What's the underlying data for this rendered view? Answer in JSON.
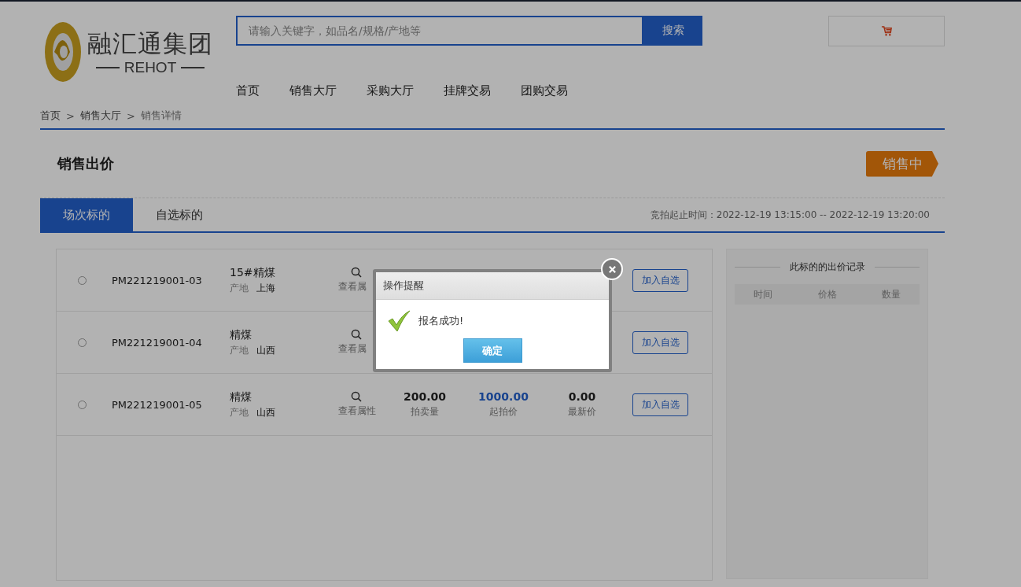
{
  "logo": {
    "name": "融汇通集团",
    "sub": "REHOT"
  },
  "search": {
    "placeholder": "请输入关键字，如品名/规格/产地等",
    "button": "搜索"
  },
  "nav": [
    "首页",
    "销售大厅",
    "采购大厅",
    "挂牌交易",
    "团购交易"
  ],
  "breadcrumb": [
    "首页",
    "销售大厅",
    "销售详情"
  ],
  "breadcrumb_sep": ">",
  "title": "销售出价",
  "status_badge": "销售中",
  "tabs": [
    {
      "label": "场次标的",
      "selected": true
    },
    {
      "label": "自选标的",
      "selected": false
    }
  ],
  "time_range": "竞拍起止时间：2022-12-19 13:15:00 -- 2022-12-19 13:20:00",
  "lots": [
    {
      "selected": false,
      "code": "PM221219001-03",
      "product": "15#精煤",
      "origin_label": "产地",
      "origin": "上海",
      "view": "查看属",
      "action": "加入自选"
    },
    {
      "selected": false,
      "code": "PM221219001-04",
      "product": "精煤",
      "origin_label": "产地",
      "origin": "山西",
      "view": "查看属",
      "action": "加入自选"
    },
    {
      "selected": false,
      "code": "PM221219001-05",
      "product": "精煤",
      "origin_label": "产地",
      "origin": "山西",
      "view": "查看属性",
      "qty": "200.00",
      "qty_label": "拍卖量",
      "price": "1000.00",
      "price_label": "起拍价",
      "latest": "0.00",
      "latest_label": "最新价",
      "action": "加入自选"
    }
  ],
  "bid_record": {
    "title": "此标的的出价记录",
    "columns": [
      "时间",
      "价格",
      "数量"
    ]
  },
  "dialog": {
    "title": "操作提醒",
    "message": "报名成功!",
    "button": "确定"
  }
}
